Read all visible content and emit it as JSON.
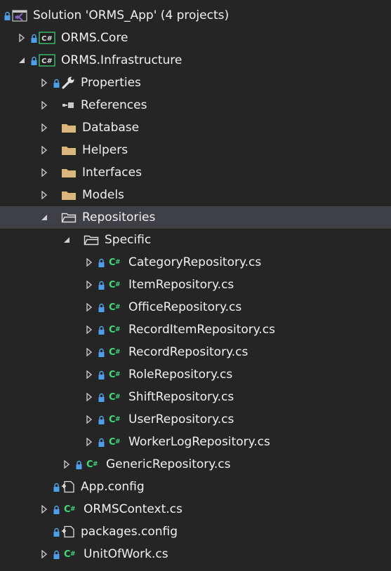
{
  "solution_explorer": {
    "solution_label": "Solution 'ORMS_App' (4 projects)",
    "projects": [
      {
        "label": "ORMS.Core",
        "expanded": false
      },
      {
        "label": "ORMS.Infrastructure",
        "expanded": true
      }
    ],
    "infrastructure_children": {
      "properties": "Properties",
      "references": "References",
      "folders": [
        "Database",
        "Helpers",
        "Interfaces",
        "Models"
      ],
      "repositories": "Repositories",
      "specific": "Specific",
      "specific_files": [
        "CategoryRepository.cs",
        "ItemRepository.cs",
        "OfficeRepository.cs",
        "RecordItemRepository.cs",
        "RecordRepository.cs",
        "RoleRepository.cs",
        "ShiftRepository.cs",
        "UserRepository.cs",
        "WorkerLogRepository.cs"
      ],
      "generic_file": "GenericRepository.cs",
      "app_config": "App.config",
      "context_file": "ORMSContext.cs",
      "packages_config": "packages.config",
      "unit_of_work": "UnitOfWork.cs"
    },
    "selected_item": "Repositories",
    "colors": {
      "background": "#252526",
      "selection": "#3f3f46",
      "text": "#f1f1f1",
      "folder": "#dcb67a",
      "csharp": "#3fdc77",
      "lock": "#4f9fe8",
      "vs_purple": "#865fc5"
    }
  }
}
